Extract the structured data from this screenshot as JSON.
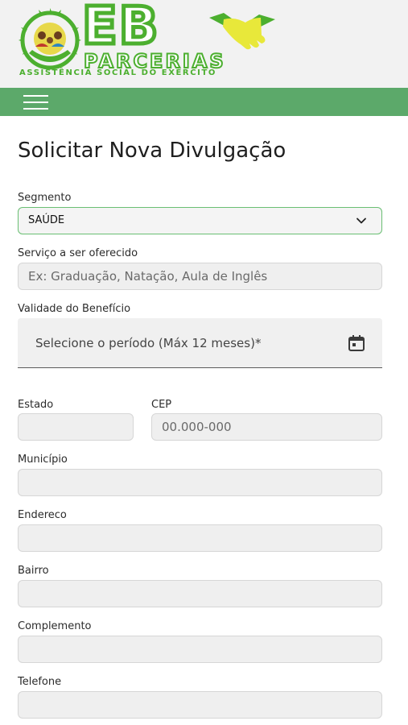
{
  "header": {
    "logo": {
      "wordmark": "EB",
      "subwordmark": "PARCERIAS",
      "tagline": "ASSISTÊNCIA SOCIAL DO EXÉRCITO"
    },
    "menu_icon": "hamburger-menu-icon"
  },
  "page": {
    "title": "Solicitar Nova Divulgação"
  },
  "form": {
    "segmento": {
      "label": "Segmento",
      "value": "SAÚDE"
    },
    "servico": {
      "label": "Serviço a ser oferecido",
      "placeholder": "Ex: Graduação, Natação, Aula de Inglês"
    },
    "validade": {
      "label": "Validade do Benefício",
      "placeholder": "Selecione o período (Máx 12 meses)*"
    },
    "estado": {
      "label": "Estado",
      "value": ""
    },
    "cep": {
      "label": "CEP",
      "placeholder": "00.000-000"
    },
    "municipio": {
      "label": "Município",
      "value": ""
    },
    "endereco": {
      "label": "Endereco",
      "value": ""
    },
    "bairro": {
      "label": "Bairro",
      "value": ""
    },
    "complemento": {
      "label": "Complemento",
      "value": ""
    },
    "telefone": {
      "label": "Telefone",
      "value": ""
    }
  },
  "colors": {
    "brand_green": "#4caf2f",
    "navbar_green": "#5ca96a",
    "select_border": "#6abf73",
    "field_bg": "#efefef",
    "handshake_yellow": "#e8e83a"
  }
}
